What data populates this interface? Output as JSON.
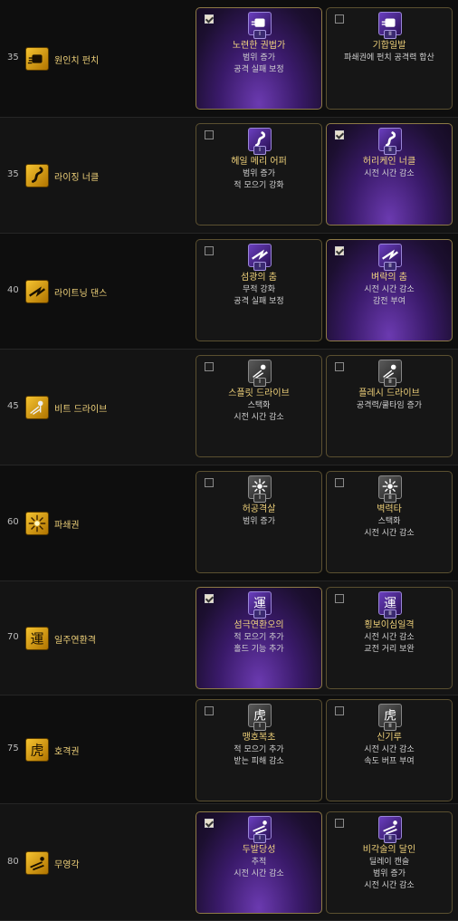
{
  "rows": [
    {
      "level": "35",
      "skill": "원인치 펀치",
      "icon": "fist-icon",
      "runes": [
        {
          "num": "I",
          "name": "노련한 권법가",
          "desc": [
            "범위 증가",
            "공격 실패 보정"
          ],
          "selected": true,
          "icon": "fist-rune-icon"
        },
        {
          "num": "II",
          "name": "기합일발",
          "desc": [
            "파쇄권에 펀치 공격력 합산"
          ],
          "selected": false,
          "icon": "fist-rune-icon"
        }
      ]
    },
    {
      "level": "35",
      "skill": "라이징 너클",
      "icon": "rising-knuckle-icon",
      "runes": [
        {
          "num": "I",
          "name": "헤일 메리 어퍼",
          "desc": [
            "범위 증가",
            "적 모으기 강화"
          ],
          "selected": false,
          "icon": "knuckle-rune-icon"
        },
        {
          "num": "II",
          "name": "허리케인 너클",
          "desc": [
            "시전 시간 감소"
          ],
          "selected": true,
          "icon": "knuckle-rune-icon"
        }
      ]
    },
    {
      "level": "40",
      "skill": "라이트닝 댄스",
      "icon": "lightning-dance-icon",
      "runes": [
        {
          "num": "I",
          "name": "섬광의 춤",
          "desc": [
            "무적 강화",
            "공격 실패 보정"
          ],
          "selected": false,
          "icon": "lightning-rune-icon"
        },
        {
          "num": "II",
          "name": "벼락의 춤",
          "desc": [
            "시전 시간 감소",
            "감전 부여"
          ],
          "selected": true,
          "icon": "lightning-rune-icon"
        }
      ]
    },
    {
      "level": "45",
      "skill": "비트 드라이브",
      "icon": "beat-drive-icon",
      "runes": [
        {
          "num": "I",
          "name": "스플릿 드라이브",
          "desc": [
            "스택화",
            "시전 시간 감소"
          ],
          "selected": false,
          "icon": "drive-rune-icon"
        },
        {
          "num": "II",
          "name": "플레시 드라이브",
          "desc": [
            "공격력/쿨타임 증가"
          ],
          "selected": false,
          "icon": "drive-rune-icon"
        }
      ]
    },
    {
      "level": "60",
      "skill": "파쇄권",
      "icon": "crush-fist-icon",
      "runes": [
        {
          "num": "I",
          "name": "허공격살",
          "desc": [
            "범위 증가"
          ],
          "selected": false,
          "icon": "burst-rune-icon"
        },
        {
          "num": "II",
          "name": "벽력타",
          "desc": [
            "스택화",
            "시전 시간 감소"
          ],
          "selected": false,
          "icon": "burst-rune-icon"
        }
      ]
    },
    {
      "level": "70",
      "skill": "일주연환격",
      "icon": "combo-strike-icon",
      "runes": [
        {
          "num": "I",
          "name": "섬극연환오의",
          "desc": [
            "적 모으기 추가",
            "홀드 기능 추가"
          ],
          "selected": true,
          "icon": "combo-rune-icon"
        },
        {
          "num": "II",
          "name": "횡보이심일격",
          "desc": [
            "시전 시간 감소",
            "교전 거리 보완"
          ],
          "selected": false,
          "icon": "combo-rune-icon"
        }
      ]
    },
    {
      "level": "75",
      "skill": "호격권",
      "icon": "tiger-fist-icon",
      "runes": [
        {
          "num": "I",
          "name": "맹호복초",
          "desc": [
            "적 모으기 추가",
            "받는 피해 감소"
          ],
          "selected": false,
          "icon": "tiger-rune-icon"
        },
        {
          "num": "II",
          "name": "신기루",
          "desc": [
            "시전 시간 감소",
            "속도 버프 부여"
          ],
          "selected": false,
          "icon": "tiger-rune-icon"
        }
      ]
    },
    {
      "level": "80",
      "skill": "무영각",
      "icon": "shadowless-kick-icon",
      "runes": [
        {
          "num": "I",
          "name": "두발당성",
          "desc": [
            "추적",
            "시전 시간 감소"
          ],
          "selected": true,
          "icon": "kick-rune-icon"
        },
        {
          "num": "II",
          "name": "비각술의 달인",
          "desc": [
            "딜레이 캔슬",
            "범위 증가",
            "시전 시간 감소"
          ],
          "selected": false,
          "icon": "kick-rune-icon"
        }
      ]
    }
  ]
}
